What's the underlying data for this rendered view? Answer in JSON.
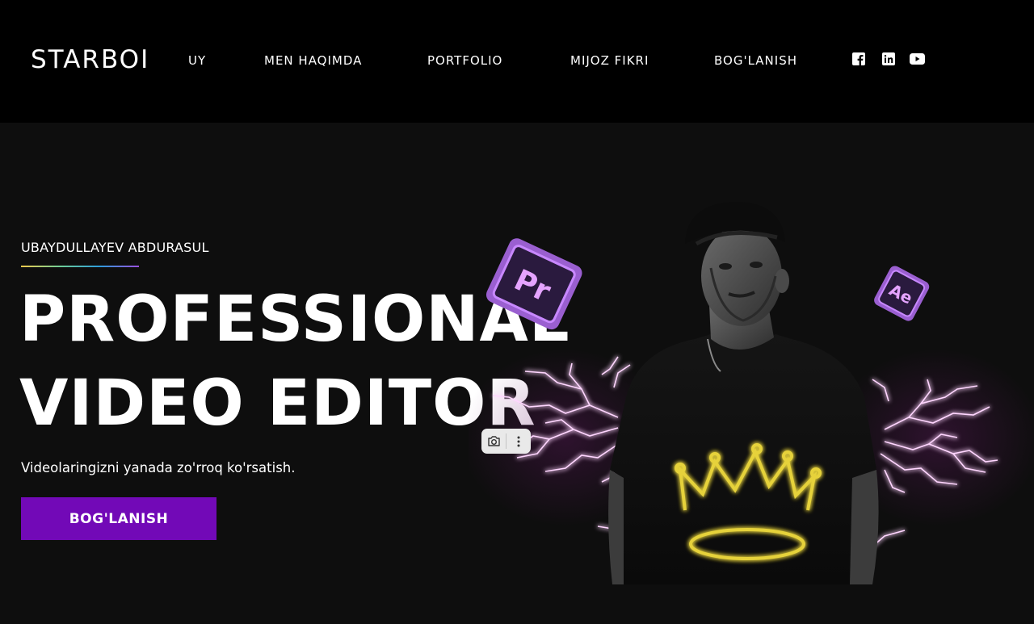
{
  "header": {
    "logo": "STARBOI",
    "nav": [
      {
        "label": "UY"
      },
      {
        "label": "MEN HAQIMDA"
      },
      {
        "label": "PORTFOLIO"
      },
      {
        "label": "MIJOZ FIKRI"
      },
      {
        "label": "BOG'LANISH"
      }
    ],
    "social": [
      {
        "icon": "facebook-icon"
      },
      {
        "icon": "linkedin-icon"
      },
      {
        "icon": "youtube-icon"
      }
    ]
  },
  "hero": {
    "subtitle": "UBAYDULLAYEV ABDURASUL",
    "headline_line1": "PROFESSIONAL",
    "headline_line2": "VIDEO EDITOR",
    "tagline": "Videolaringizni yanada zo'rroq ko'rsatish.",
    "cta_label": "BOG'LANISH",
    "badges": {
      "premiere": "Pr",
      "after_effects": "Ae"
    }
  },
  "colors": {
    "accent": "#7209b7",
    "header_bg": "#000000",
    "hero_bg": "#0e0e0e",
    "lightning": "#ff7bff",
    "crown": "#e6d23a"
  },
  "overlay_toolbar": {
    "icons": [
      "camera-icon",
      "more-vertical-icon"
    ]
  }
}
